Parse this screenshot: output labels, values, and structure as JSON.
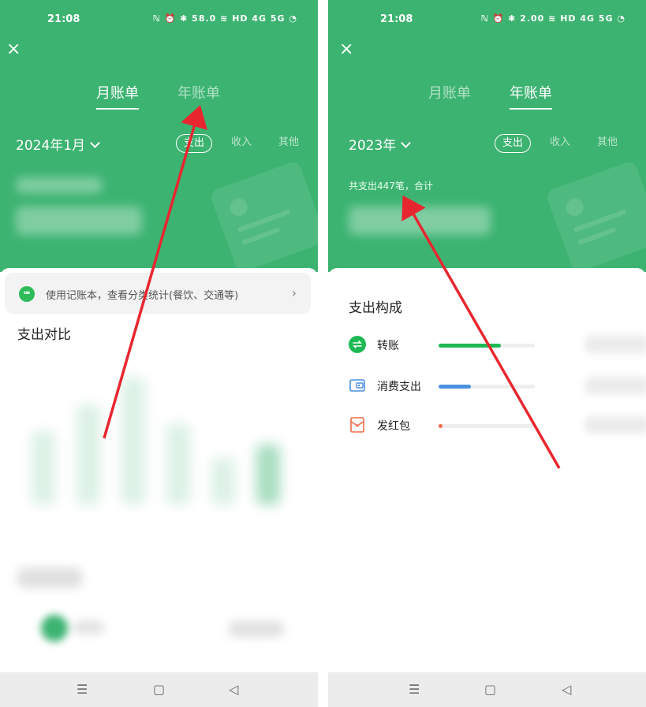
{
  "left": {
    "status_time": "21:08",
    "status_icons": "ℕ ⏰ ✱ 58.0 ≋ HD 4G 5G ◔",
    "close_label": "×",
    "tabs": [
      "月账单",
      "年账单"
    ],
    "active_tab": 0,
    "period": "2024年1月",
    "filters": [
      "支出",
      "收入",
      "其他"
    ],
    "tip": {
      "text": "使用记账本，查看分类统计(餐饮、交通等)",
      "arrow": "›"
    },
    "section_title": "支出对比",
    "chart_bar_levels": [
      0.55,
      0.75,
      0.95,
      0.6,
      0.35,
      0.45
    ]
  },
  "right": {
    "status_time": "21:08",
    "status_icons": "ℕ ⏰ ✱ 2.00 ≋ HD 4G 5G ◔",
    "close_label": "×",
    "tabs": [
      "月账单",
      "年账单"
    ],
    "active_tab": 1,
    "period": "2023年",
    "filters": [
      "支出",
      "收入",
      "其他"
    ],
    "summary": "共支出447笔，合计",
    "section_title": "支出构成",
    "categories": [
      {
        "label": "转账",
        "icon": "transfer-icon",
        "color": "#1db954",
        "level": 0.65
      },
      {
        "label": "消费支出",
        "icon": "wallet-icon",
        "color": "#4a90e2",
        "level": 0.34
      },
      {
        "label": "发红包",
        "icon": "red-packet-icon",
        "color": "#f06a4a",
        "level": 0.04
      }
    ]
  },
  "navbar": {
    "menu": "☰",
    "home": "▢",
    "back": "◁"
  },
  "colors": {
    "brand_green": "#3cb371",
    "arrow_red": "#e8262f"
  }
}
